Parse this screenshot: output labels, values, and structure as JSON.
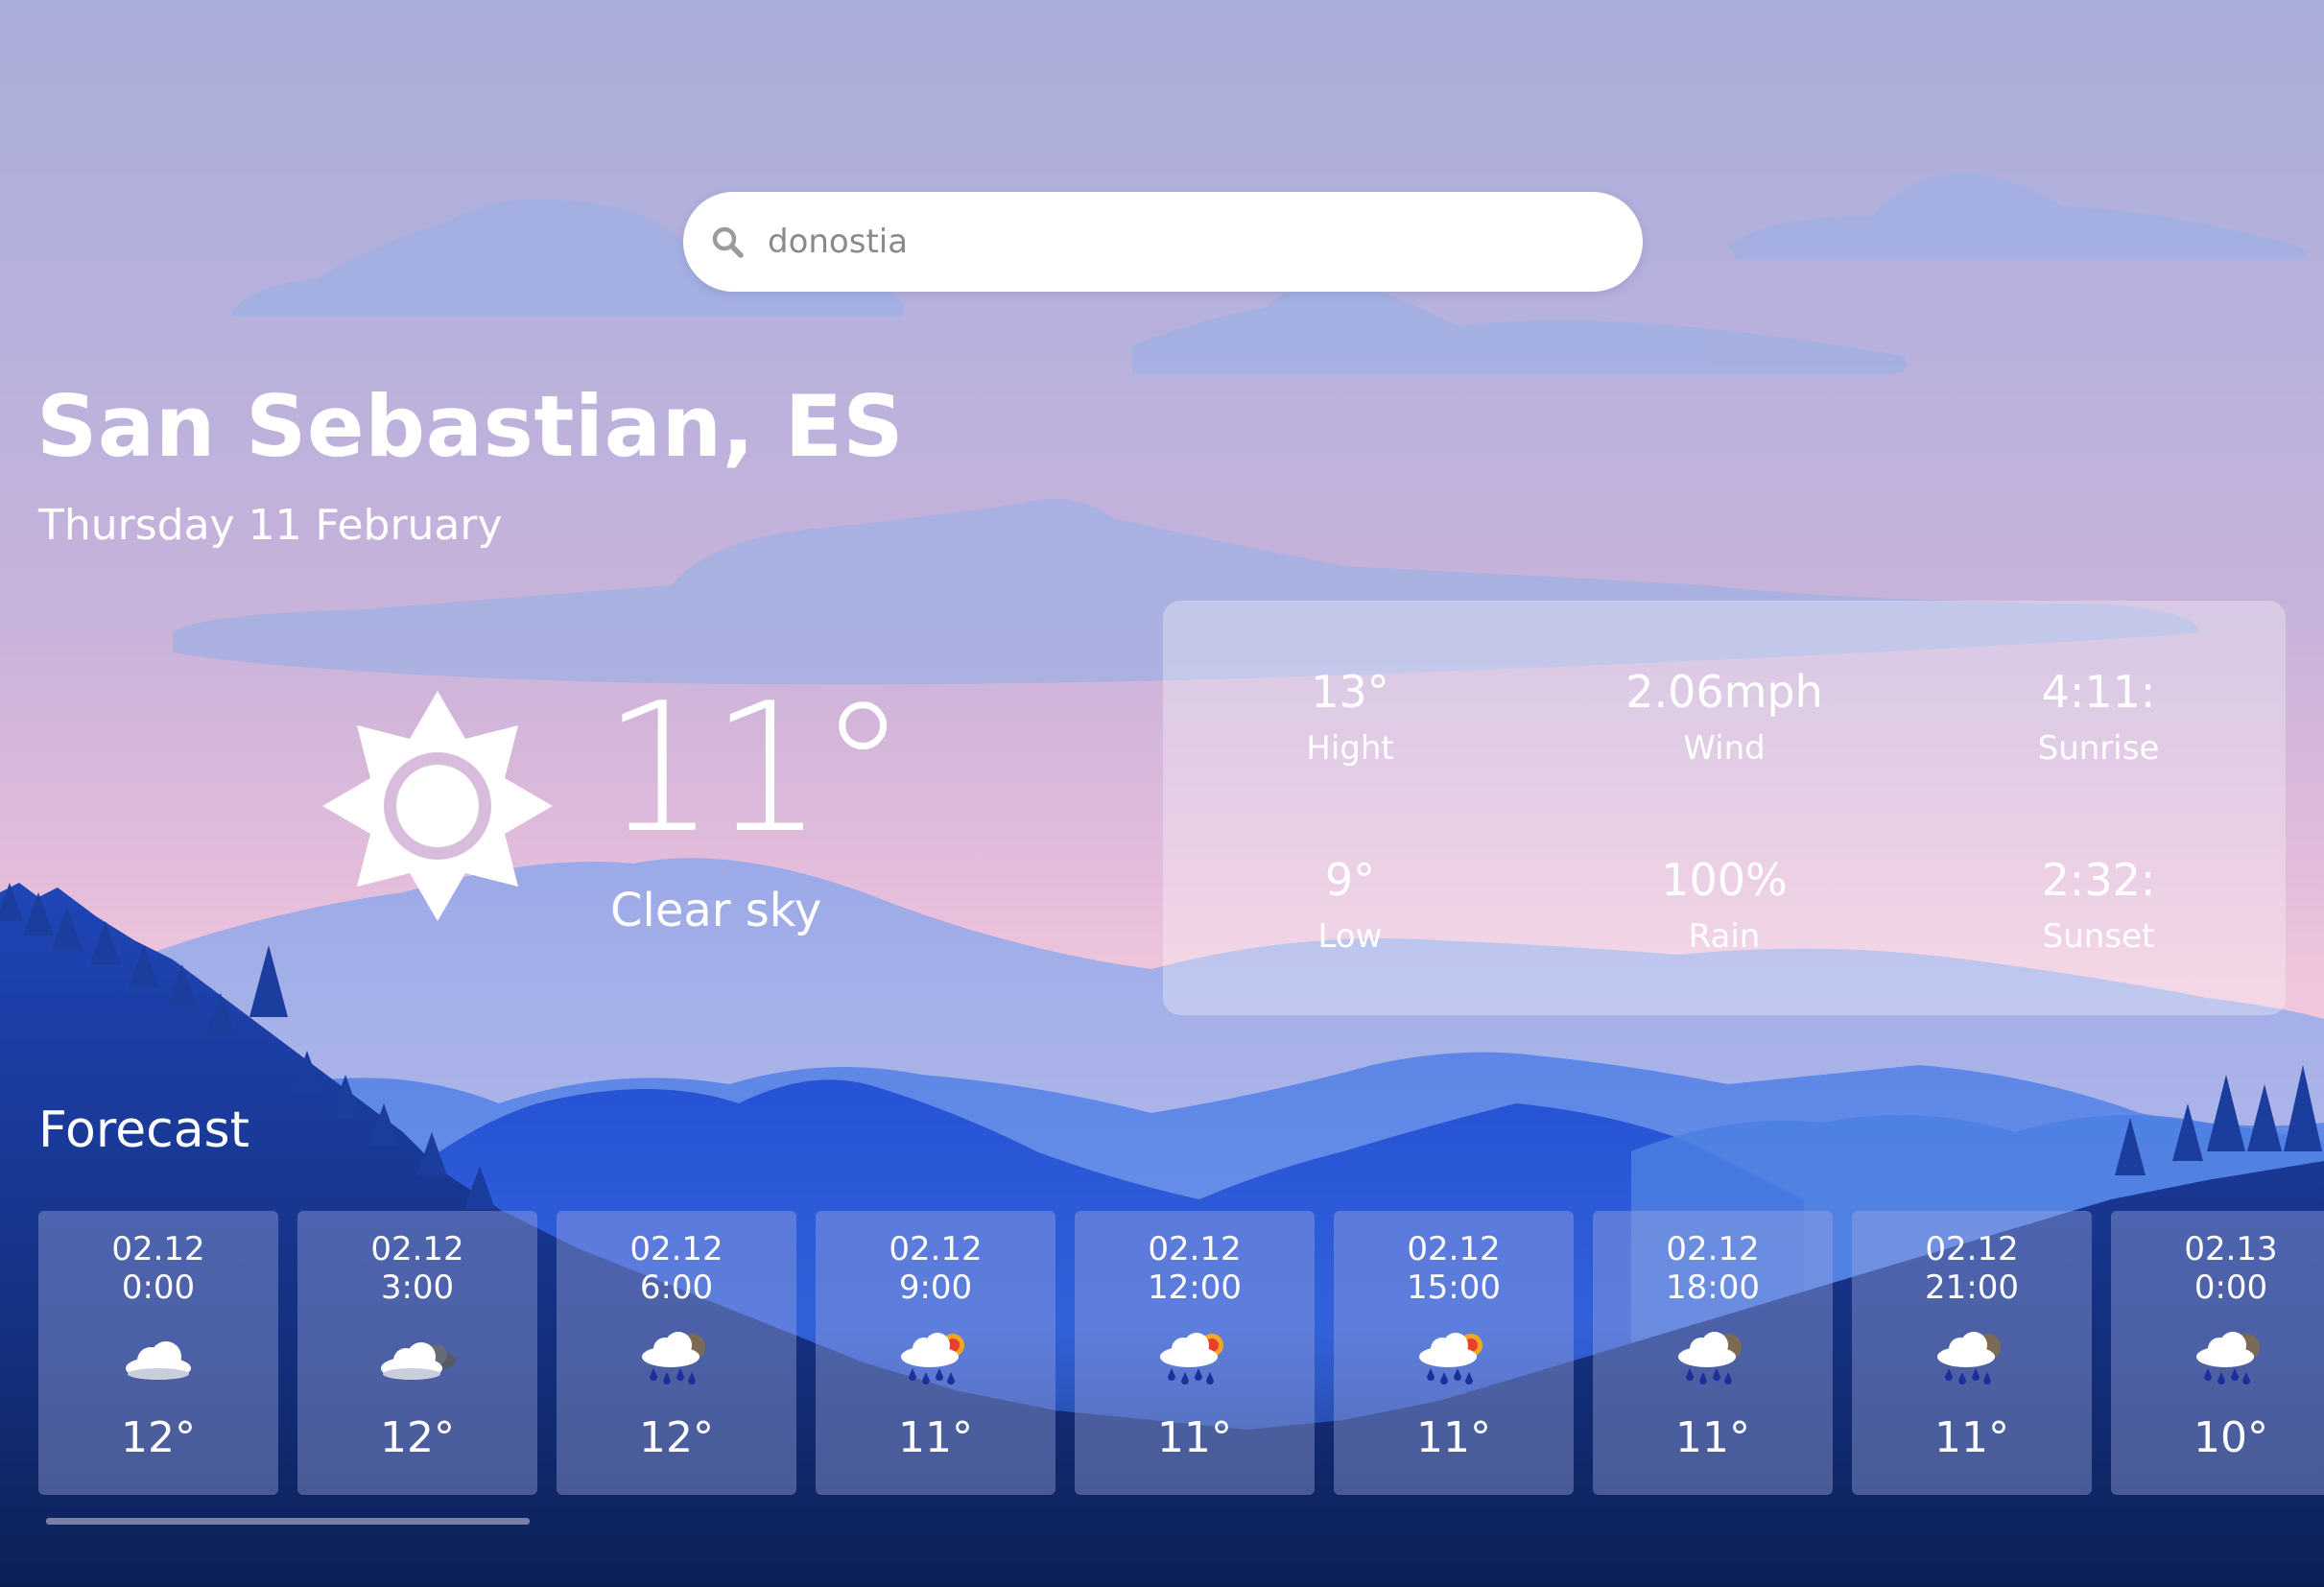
{
  "search": {
    "value": "donostia",
    "icon": "search-icon"
  },
  "location": {
    "city": "San Sebastian, ES",
    "date": "Thursday 11 February"
  },
  "current": {
    "temperature": "11°",
    "condition": "Clear sky",
    "icon": "sun-icon"
  },
  "stats": [
    {
      "value": "13°",
      "label": "Hight"
    },
    {
      "value": "2.06mph",
      "label": "Wind"
    },
    {
      "value": "4:11:",
      "label": "Sunrise"
    },
    {
      "value": "9°",
      "label": "Low"
    },
    {
      "value": "100%",
      "label": "Rain"
    },
    {
      "value": "2:32:",
      "label": "Sunset"
    }
  ],
  "forecast": {
    "title": "Forecast",
    "items": [
      {
        "date": "02.12",
        "time": "0:00",
        "temp": "12°",
        "icon": "cloud-icon"
      },
      {
        "date": "02.12",
        "time": "3:00",
        "temp": "12°",
        "icon": "cloud-dark-icon"
      },
      {
        "date": "02.12",
        "time": "6:00",
        "temp": "12°",
        "icon": "rain-cloud-icon"
      },
      {
        "date": "02.12",
        "time": "9:00",
        "temp": "11°",
        "icon": "rain-sun-icon"
      },
      {
        "date": "02.12",
        "time": "12:00",
        "temp": "11°",
        "icon": "rain-sun-icon"
      },
      {
        "date": "02.12",
        "time": "15:00",
        "temp": "11°",
        "icon": "rain-sun-icon"
      },
      {
        "date": "02.12",
        "time": "18:00",
        "temp": "11°",
        "icon": "rain-cloud-icon"
      },
      {
        "date": "02.12",
        "time": "21:00",
        "temp": "11°",
        "icon": "rain-cloud-icon"
      },
      {
        "date": "02.13",
        "time": "0:00",
        "temp": "10°",
        "icon": "rain-cloud-icon"
      }
    ]
  },
  "colors": {
    "sky_top": "#a9add9",
    "sky_bottom": "#efc6dc",
    "mountain_blue": "#2a5bd8",
    "forest_dark": "#15327d",
    "sun_ring": "#d9bddc"
  }
}
